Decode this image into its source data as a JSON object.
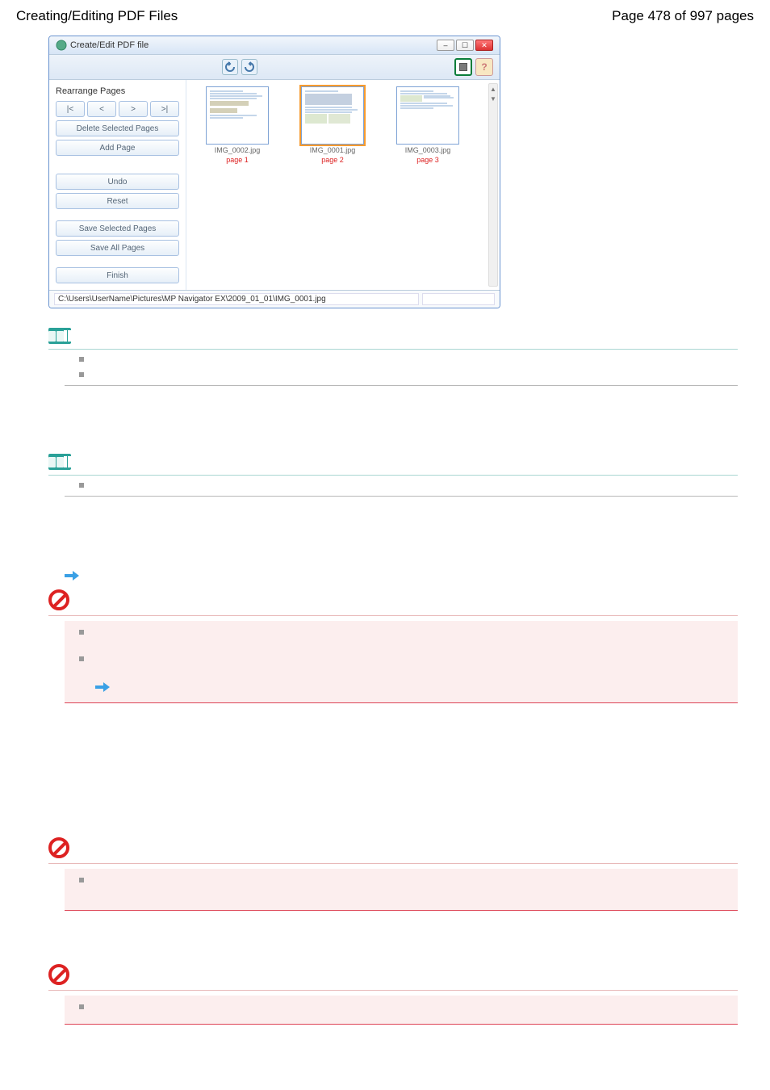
{
  "header": {
    "title": "Creating/Editing PDF Files",
    "page_info": "Page 478 of 997 pages"
  },
  "window": {
    "title": "Create/Edit PDF file",
    "toolbar": {
      "icon1": "rotate-left-icon",
      "icon2": "rotate-right-icon"
    },
    "sidebar": {
      "section_label": "Rearrange Pages",
      "nav": {
        "first": "|<",
        "prev": "<",
        "next": ">",
        "last": ">|"
      },
      "delete_selected": "Delete Selected Pages",
      "add_page": "Add Page",
      "undo": "Undo",
      "reset": "Reset",
      "save_selected": "Save Selected Pages",
      "save_all": "Save All Pages",
      "finish": "Finish"
    },
    "thumbs": [
      {
        "file": "IMG_0002.jpg",
        "page": "page 1"
      },
      {
        "file": "IMG_0001.jpg",
        "page": "page 2"
      },
      {
        "file": "IMG_0003.jpg",
        "page": "page 3"
      }
    ],
    "status_path": "C:\\Users\\UserName\\Pictures\\MP Navigator EX\\2009_01_01\\IMG_0001.jpg"
  }
}
